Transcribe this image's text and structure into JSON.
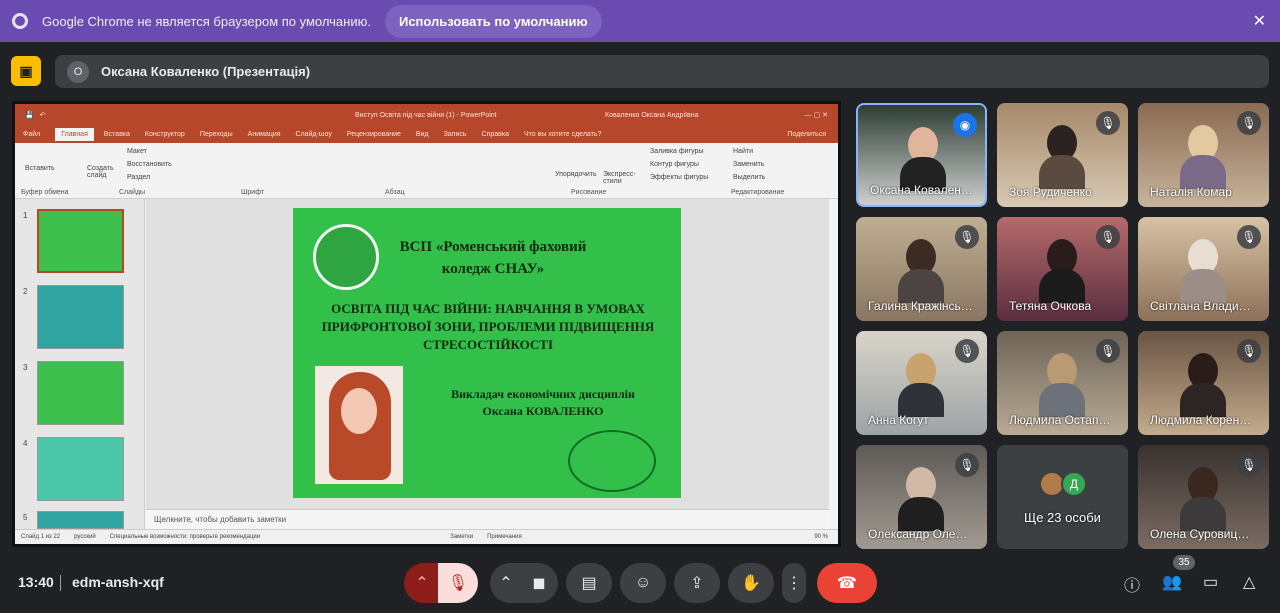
{
  "banner": {
    "message": "Google Chrome не является браузером по умолчанию.",
    "button": "Использовать по умолчанию",
    "close": "✕"
  },
  "presenter": {
    "avatar_letter": "O",
    "name": "Оксана Коваленко (Презентація)"
  },
  "ppt": {
    "window_title": "Виступ Освіта під час війни (1) - PowerPoint",
    "user": "Коваленко Оксана Андріївна",
    "tabs": [
      "Файл",
      "Главная",
      "Вставка",
      "Конструктор",
      "Переходы",
      "Анимация",
      "Слайд-шоу",
      "Рецензирование",
      "Вид",
      "Запись",
      "Справка"
    ],
    "search": "Что вы хотите сделать?",
    "share": "Поделиться",
    "ribbon_groups": [
      "Буфер обмена",
      "Слайды",
      "Шрифт",
      "Абзац",
      "Рисование",
      "Редактирование"
    ],
    "ribbon_labels": {
      "paste": "Вставить",
      "create_slide": "Создать слайд",
      "layout": "Макет",
      "restore": "Восстановить",
      "section": "Раздел",
      "arrange": "Упорядочить",
      "express_styles": "Экспресс-стили",
      "fill": "Заливка фигуры",
      "outline": "Контур фигуры",
      "effects": "Эффекты фигуры",
      "find": "Найти",
      "replace": "Заменить",
      "select": "Выделить"
    },
    "thumb_numbers": [
      "1",
      "2",
      "3",
      "4",
      "5"
    ],
    "notes_placeholder": "Щелкните, чтобы добавить заметки",
    "status": {
      "slide": "Слайд 1 из 22",
      "lang": "русский",
      "access": "Специальные возможности: проверьте рекомендации",
      "notes": "Заметки",
      "comments": "Примечания",
      "zoom": "90 %"
    },
    "slide": {
      "college": "ВСП «Роменський фаховий коледж СНАУ»",
      "topic": "ОСВІТА ПІД ЧАС ВІЙНИ: НАВЧАННЯ В УМОВАХ ПРИФРОНТОВОЇ ЗОНИ, ПРОБЛЕМИ ПІДВИЩЕННЯ СТРЕСОСТІЙКОСТІ",
      "teacher_role": "Викладач економічних дисциплін",
      "teacher_name": "Оксана КОВАЛЕНКО"
    }
  },
  "participants": [
    {
      "name": "Оксана Ковален…",
      "mic": "speaking"
    },
    {
      "name": "Зоя Рудиченко",
      "mic": "muted"
    },
    {
      "name": "Наталія Комар",
      "mic": "muted"
    },
    {
      "name": "Галина Кражінсь…",
      "mic": "muted"
    },
    {
      "name": "Тетяна Очкова",
      "mic": "muted"
    },
    {
      "name": "Світлана Влади…",
      "mic": "muted"
    },
    {
      "name": "Анна Когут",
      "mic": "muted"
    },
    {
      "name": "Людмила Остап…",
      "mic": "muted"
    },
    {
      "name": "Людмила Корен…",
      "mic": "muted"
    },
    {
      "name": "Олександр Оле…",
      "mic": "muted"
    },
    {
      "name": "Олена Суровиц…",
      "mic": "muted"
    }
  ],
  "more_tile": {
    "label": "Ще 23 особи",
    "avatar_letter": "Д"
  },
  "bottom": {
    "time": "13:40",
    "meeting_code": "edm-ansh-xqf",
    "people_count": "35"
  },
  "colors": {
    "banner": "#6a4bb0",
    "ppt_accent": "#b7472a",
    "slide_green": "#33c04a",
    "end_call": "#ea4335"
  }
}
